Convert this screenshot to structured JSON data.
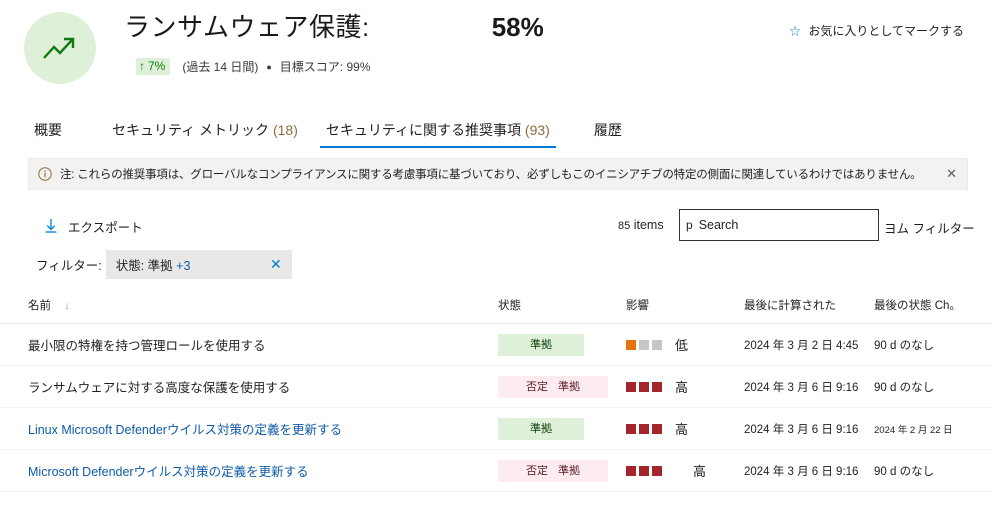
{
  "header": {
    "icon_name": "trending-up-icon",
    "title": "ランサムウェア保護:",
    "score": "58%",
    "trend_arrow": "↑",
    "trend_value": "7%",
    "trend_period": "(過去 14 日間)",
    "dot": "●",
    "target_score": "目標スコア: 99%",
    "favorite_star": "☆",
    "favorite_label": "お気に入りとしてマークする",
    "accent_green": "#107c10",
    "badge_bg": "#dff0d8"
  },
  "tabs": [
    {
      "label": "概要",
      "count": "",
      "active": false
    },
    {
      "label": "セキュリティ メトリック",
      "count": "(18)",
      "active": false
    },
    {
      "label": "セキュリティに関する推奨事項",
      "count": "(93)",
      "active": true
    },
    {
      "label": "履歴",
      "count": "",
      "active": false
    }
  ],
  "notice": {
    "icon_name": "info-icon",
    "message": "注: これらの推奨事項は、グローバルなコンプライアンスに関する考慮事項に基づいており、必ずしもこのイニシアチブの特定の側面に関連しているわけではありません。",
    "close_label": "✕"
  },
  "commandbar": {
    "export_icon": "download-icon",
    "export_label": "エクスポート",
    "item_count": "85",
    "items_label": "items",
    "search_placeholder": "Search",
    "search_value": "",
    "search_icon": "search-icon",
    "filter_link": "ヨム フィルター"
  },
  "filterrow": {
    "label": "フィルター:",
    "chip_text": "状態: 準拠",
    "chip_plus": "+3",
    "chip_clear": "✕"
  },
  "table": {
    "columns": [
      {
        "label": "名前",
        "sort": "↓"
      },
      {
        "label": "状態",
        "sort": ""
      },
      {
        "label": "影響",
        "sort": ""
      },
      {
        "label": "最後に計算された",
        "sort": ""
      },
      {
        "label": "最後の状態 Ch。",
        "sort": ""
      }
    ],
    "rows": [
      {
        "name": "最小限の特権を持つ管理ロールを使用する",
        "name_style": "dark",
        "status": "準拠",
        "status_sub": "",
        "status_kind": "compliant",
        "impact_label": "低",
        "impact_level": 1,
        "impact_kind": "low",
        "last_calculated": "2024 年 3 月 2 日 4:45",
        "last_state_change": "90 d のなし",
        "last_state_small": false
      },
      {
        "name": "ランサムウェアに対する高度な保護を使用する",
        "name_style": "dark",
        "status": "否定",
        "status_sub": "準拠",
        "status_kind": "noncompliant",
        "impact_label": "高",
        "impact_level": 3,
        "impact_kind": "high",
        "last_calculated": "2024 年 3 月 6 日 9:16",
        "last_state_change": "90 d のなし",
        "last_state_small": false
      },
      {
        "name": "Linux Microsoft Defenderウイルス対策の定義を更新する",
        "name_style": "link",
        "status": "準拠",
        "status_sub": "",
        "status_kind": "compliant",
        "impact_label": "高",
        "impact_level": 3,
        "impact_kind": "high",
        "last_calculated": "2024 年 3 月 6 日 9:16",
        "last_state_change": "2024 年 2 月 22 日",
        "last_state_small": true
      },
      {
        "name": "Microsoft Defenderウイルス対策の定義を更新する",
        "name_style": "link",
        "status": "否定",
        "status_sub": "準拠",
        "status_kind": "noncompliant",
        "impact_label": "高",
        "impact_level": 3,
        "impact_kind": "high",
        "last_calculated": "2024 年 3 月 6 日 9:16",
        "last_state_change": "90 d のなし",
        "last_state_small": false
      }
    ]
  }
}
